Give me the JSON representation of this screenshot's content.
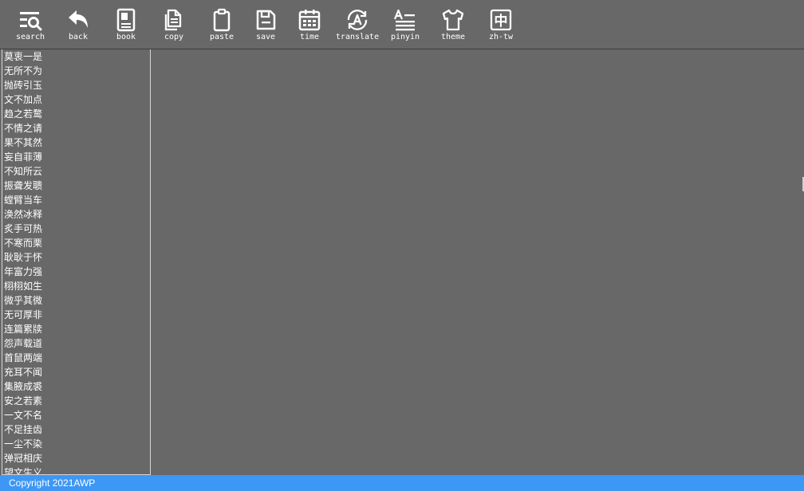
{
  "toolbar": {
    "search": "search",
    "back": "back",
    "book": "book",
    "copy": "copy",
    "paste": "paste",
    "save": "save",
    "time": "time",
    "translate": "translate",
    "pinyin": "pinyin",
    "theme": "theme",
    "zhtw": "zh-tw",
    "zhtw_glyph": "中"
  },
  "idioms": [
    "莫衷一是",
    "无所不为",
    "抛砖引玉",
    "文不加点",
    "趋之若鹜",
    "不情之请",
    "果不其然",
    "妄自菲薄",
    "不知所云",
    "振聋发聩",
    "螳臂当车",
    "涣然冰释",
    "炙手可热",
    "不寒而栗",
    "耿耿于怀",
    "年富力强",
    "栩栩如生",
    "微乎其微",
    "无可厚非",
    "连篇累牍",
    "怨声载道",
    "首鼠两端",
    "充耳不闻",
    "集腋成裘",
    "安之若素",
    "一文不名",
    "不足挂齿",
    "一尘不染",
    "弹冠相庆",
    "望文生义"
  ],
  "status": {
    "copyright": "Copyright 2021AWP"
  },
  "colors": {
    "background": "#686868",
    "statusbar": "#3d97f4",
    "text": "#ffffff"
  }
}
